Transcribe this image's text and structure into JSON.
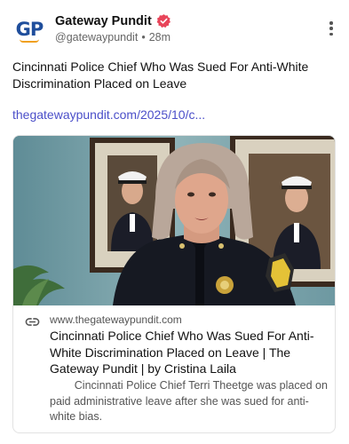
{
  "account": {
    "avatar_text": "GP",
    "display_name": "Gateway Pundit",
    "handle": "@gatewaypundit",
    "separator": "•",
    "time_ago": "28m",
    "verified_icon": "verified-badge-icon",
    "more_icon": "more-vertical-icon"
  },
  "post": {
    "text": "Cincinnati Police Chief Who Was Sued For Anti-White Discrimination Placed on Leave",
    "link": "thegatewaypundit.com/2025/10/c..."
  },
  "card": {
    "image_alt": "Police chief in uniform speaking in front of framed portraits",
    "domain": "www.thegatewaypundit.com",
    "title": "Cincinnati Police Chief Who Was Sued For Anti-White Discrimination Placed on Leave | The Gateway Pundit | by Cristina Laila",
    "description": "        Cincinnati Police Chief Terri Theetge was placed on paid administrative leave after she was sued for anti-white bias.",
    "link_icon": "link-icon"
  },
  "colors": {
    "link": "#4b4fc9",
    "verified": "#e8455a",
    "brand_blue": "#1f4e9c",
    "brand_orange": "#f0a020"
  }
}
